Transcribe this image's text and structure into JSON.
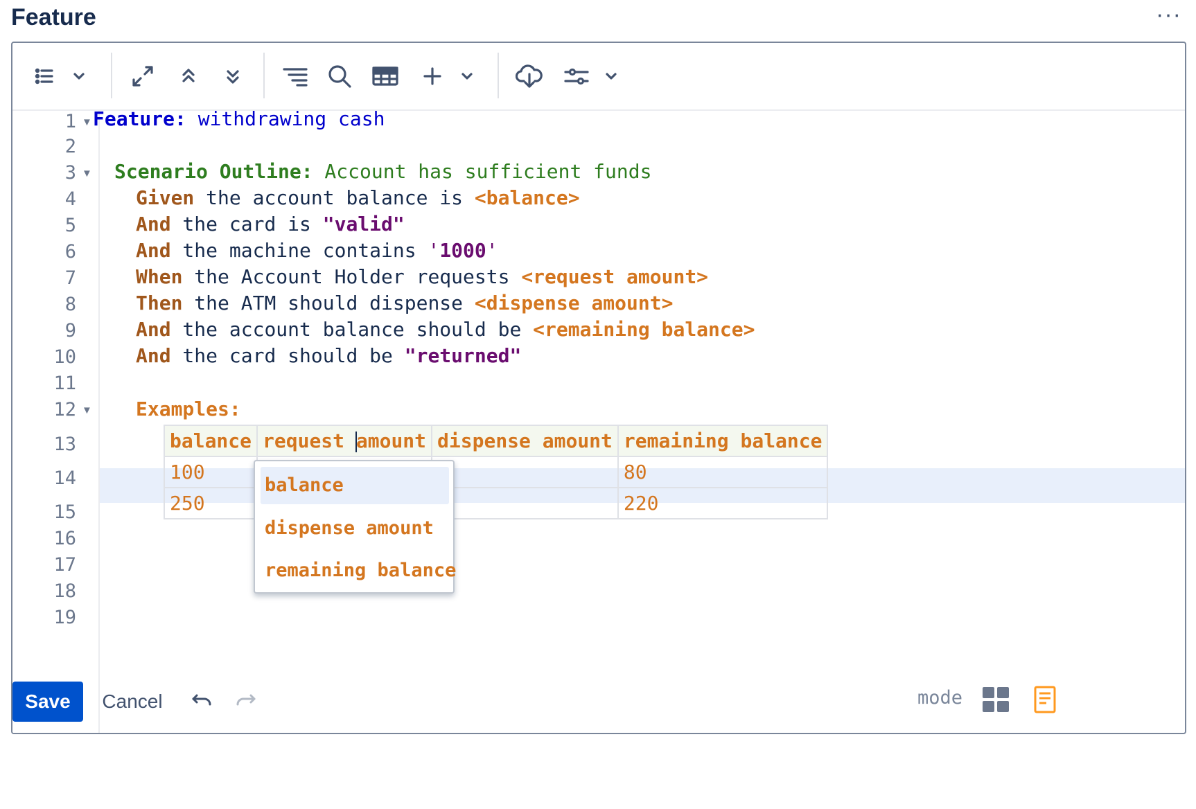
{
  "header": {
    "title": "Feature",
    "more_menu": "···"
  },
  "toolbar": {
    "icons": [
      "list-icon",
      "chevron-down-icon",
      "expand-icon",
      "collapse-up-icon",
      "collapse-down-icon",
      "format-icon",
      "search-icon",
      "table-icon",
      "plus-icon",
      "chevron-down-icon",
      "cloud-download-icon",
      "settings-sliders-icon",
      "chevron-down-icon"
    ]
  },
  "editor": {
    "line_numbers": [
      "1",
      "2",
      "3",
      "4",
      "5",
      "6",
      "7",
      "8",
      "9",
      "10",
      "11",
      "12",
      "13",
      "14",
      "15",
      "16",
      "17",
      "18",
      "19"
    ],
    "fold_marker": "▼",
    "lines": {
      "l1": {
        "kw": "Feature:",
        "text": " withdrawing cash"
      },
      "l3": {
        "kw": "Scenario Outline:",
        "text": " Account has sufficient funds"
      },
      "l4": {
        "kw": "Given",
        "text": " the account balance is ",
        "param": "<balance>"
      },
      "l5": {
        "kw": "And",
        "text": " the card is ",
        "str": "\"valid\""
      },
      "l6": {
        "kw": "And",
        "text": " the machine contains ",
        "q1": "'",
        "str": "1000",
        "q2": "'"
      },
      "l7": {
        "kw": "When",
        "text": " the Account Holder requests ",
        "param": "<request amount>"
      },
      "l8": {
        "kw": "Then",
        "text": " the ATM should dispense ",
        "param": "<dispense amount>"
      },
      "l9": {
        "kw": "And",
        "text": " the account balance should be ",
        "param": "<remaining balance>"
      },
      "l10": {
        "kw": "And",
        "text": " the card should be ",
        "str": "\"returned\""
      },
      "l12": {
        "kw": "Examples:"
      }
    },
    "examples_table": {
      "headers": [
        "balance",
        "request ",
        "amount",
        "dispense amount",
        "remaining balance"
      ],
      "rows": [
        [
          "100",
          "",
          "",
          "80"
        ],
        [
          "250",
          "",
          "",
          "220"
        ]
      ]
    },
    "autocomplete": {
      "items": [
        "balance",
        "dispense amount",
        "remaining balance"
      ],
      "selected_index": 0
    }
  },
  "footer": {
    "save_label": "Save",
    "cancel_label": "Cancel",
    "mode_label": "mode"
  },
  "colors": {
    "primary": "#0052cc",
    "keyword_feature": "#0000cc",
    "keyword_scenario": "#2e7d1f",
    "keyword_step": "#a0571c",
    "parameter": "#d4761f",
    "string": "#6a0d6f",
    "highlight": "#ffff3c"
  }
}
